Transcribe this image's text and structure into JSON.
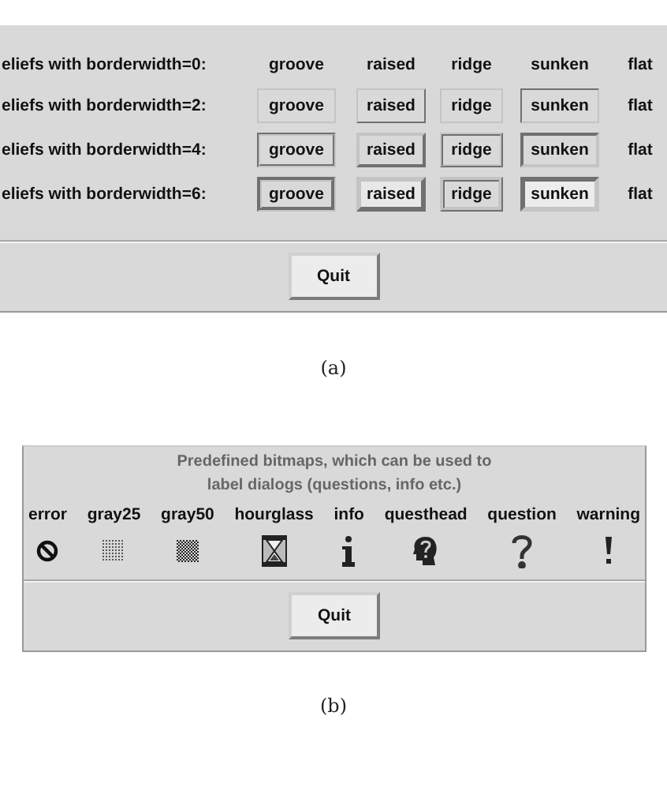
{
  "relief_window": {
    "rows": [
      {
        "label": "eliefs with borderwidth=0:",
        "kind": "none",
        "cells": [
          {
            "text": "groove",
            "kind": "groove"
          },
          {
            "text": "raised",
            "kind": "raised"
          },
          {
            "text": "ridge",
            "kind": "ridge"
          },
          {
            "text": "sunken",
            "kind": "sunken"
          },
          {
            "text": "flat",
            "kind": "flat"
          }
        ]
      },
      {
        "label": "eliefs with borderwidth=2:",
        "kind": "thin",
        "cells": [
          {
            "text": "groove",
            "kind": "groove"
          },
          {
            "text": "raised",
            "kind": "raised"
          },
          {
            "text": "ridge",
            "kind": "ridge"
          },
          {
            "text": "sunken",
            "kind": "sunken"
          },
          {
            "text": "flat",
            "kind": "flat"
          }
        ]
      },
      {
        "label": "eliefs with borderwidth=4:",
        "kind": "medium",
        "cells": [
          {
            "text": "groove",
            "kind": "groove"
          },
          {
            "text": "raised",
            "kind": "raised"
          },
          {
            "text": "ridge",
            "kind": "ridge"
          },
          {
            "text": "sunken",
            "kind": "sunken"
          },
          {
            "text": "flat",
            "kind": "flat"
          }
        ]
      },
      {
        "label": "eliefs with borderwidth=6:",
        "kind": "thick",
        "cells": [
          {
            "text": "groove",
            "kind": "groove"
          },
          {
            "text": "raised",
            "kind": "raised"
          },
          {
            "text": "ridge",
            "kind": "ridge"
          },
          {
            "text": "sunken",
            "kind": "sunken"
          },
          {
            "text": "flat",
            "kind": "flat"
          }
        ]
      }
    ],
    "quit_button": "Quit"
  },
  "caption_a": "(a)",
  "bitmap_window": {
    "description": "Predefined bitmaps, which can be used to\nlabel dialogs (questions, info etc.)",
    "bitmaps": [
      {
        "label": "error",
        "kind": "error"
      },
      {
        "label": "gray25",
        "kind": "gray25"
      },
      {
        "label": "gray50",
        "kind": "gray50"
      },
      {
        "label": "hourglass",
        "kind": "hourglass"
      },
      {
        "label": "info",
        "kind": "info"
      },
      {
        "label": "questhead",
        "kind": "questhead"
      },
      {
        "label": "question",
        "kind": "question"
      },
      {
        "label": "warning",
        "kind": "warning"
      }
    ],
    "quit_button": "Quit"
  },
  "caption_b": "(b)"
}
